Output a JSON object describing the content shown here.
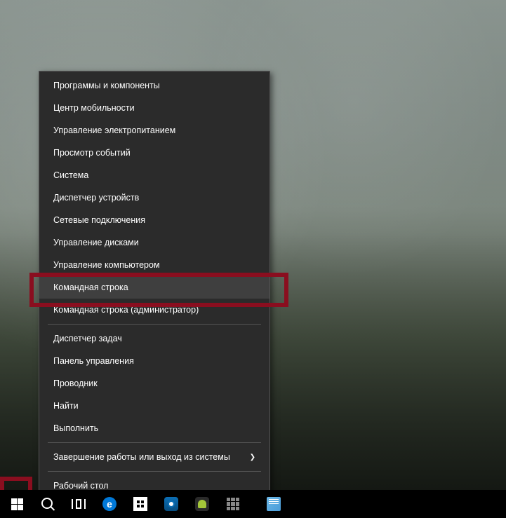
{
  "menu": {
    "items": [
      {
        "label": "Программы и компоненты"
      },
      {
        "label": "Центр мобильности"
      },
      {
        "label": "Управление электропитанием"
      },
      {
        "label": "Просмотр событий"
      },
      {
        "label": "Система"
      },
      {
        "label": "Диспетчер устройств"
      },
      {
        "label": "Сетевые подключения"
      },
      {
        "label": "Управление дисками"
      },
      {
        "label": "Управление компьютером"
      },
      {
        "label": "Командная строка",
        "hovered": true
      },
      {
        "label": "Командная строка (администратор)"
      },
      {
        "separator": true
      },
      {
        "label": "Диспетчер задач"
      },
      {
        "label": "Панель управления"
      },
      {
        "label": "Проводник"
      },
      {
        "label": "Найти"
      },
      {
        "label": "Выполнить"
      },
      {
        "separator": true
      },
      {
        "label": "Завершение работы или выход из системы",
        "submenu": true
      },
      {
        "separator": true
      },
      {
        "label": "Рабочий стол"
      }
    ]
  },
  "taskbar": {
    "start": "start-button",
    "search": "search-button",
    "taskview": "task-view-button",
    "apps": [
      {
        "name": "edge",
        "label": "e"
      },
      {
        "name": "store"
      },
      {
        "name": "teamviewer"
      },
      {
        "name": "android"
      },
      {
        "name": "all-apps"
      },
      {
        "name": "notepad"
      }
    ]
  },
  "colors": {
    "menu_bg": "#2b2b2b",
    "menu_hover": "#3f3f3f",
    "highlight": "#8a0e1f",
    "taskbar": "#000000"
  }
}
